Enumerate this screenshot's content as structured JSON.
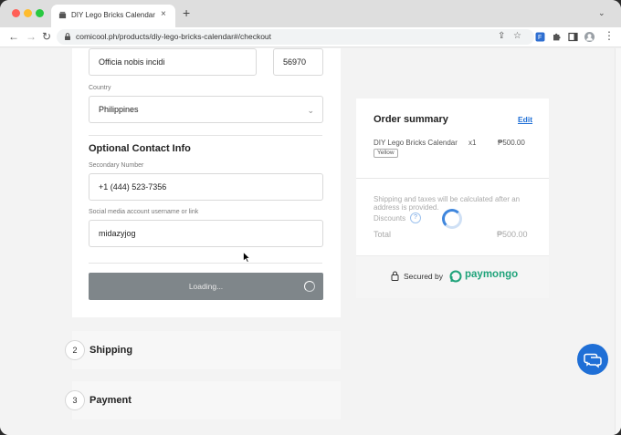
{
  "browser": {
    "tab_title": "DIY Lego Bricks Calendar | Co",
    "tab_close": "×",
    "new_tab": "+",
    "url": "comicool.ph/products/diy-lego-bricks-calendar#/checkout"
  },
  "form": {
    "address_value": "Officia nobis incidi",
    "postal_value": "56970",
    "country_label": "Country",
    "country_value": "Philippines",
    "optional_title": "Optional Contact Info",
    "secondary_label": "Secondary Number",
    "secondary_value": "+1 (444) 523-7356",
    "social_label": "Social media account username or link",
    "social_value": "midazyjog",
    "loading_label": "Loading..."
  },
  "steps": [
    {
      "number": "2",
      "label": "Shipping"
    },
    {
      "number": "3",
      "label": "Payment"
    }
  ],
  "summary": {
    "title": "Order summary",
    "edit_label": "Edit",
    "item_name": "DIY Lego Bricks Calendar",
    "item_qty": "x1",
    "item_price": "₱500.00",
    "item_variant": "Yellow",
    "shipping_note": "Shipping and taxes will be calculated after an address is provided.",
    "discounts_label": "Discounts",
    "discount_help": "?",
    "total_label": "Total",
    "total_value": "₱500.00",
    "secured_label": "Secured by",
    "provider_name": "paymongo"
  },
  "colors": {
    "accent": "#1f6fd6",
    "paymongo_green": "#1fa37a",
    "loading_button": "#7f868a"
  }
}
